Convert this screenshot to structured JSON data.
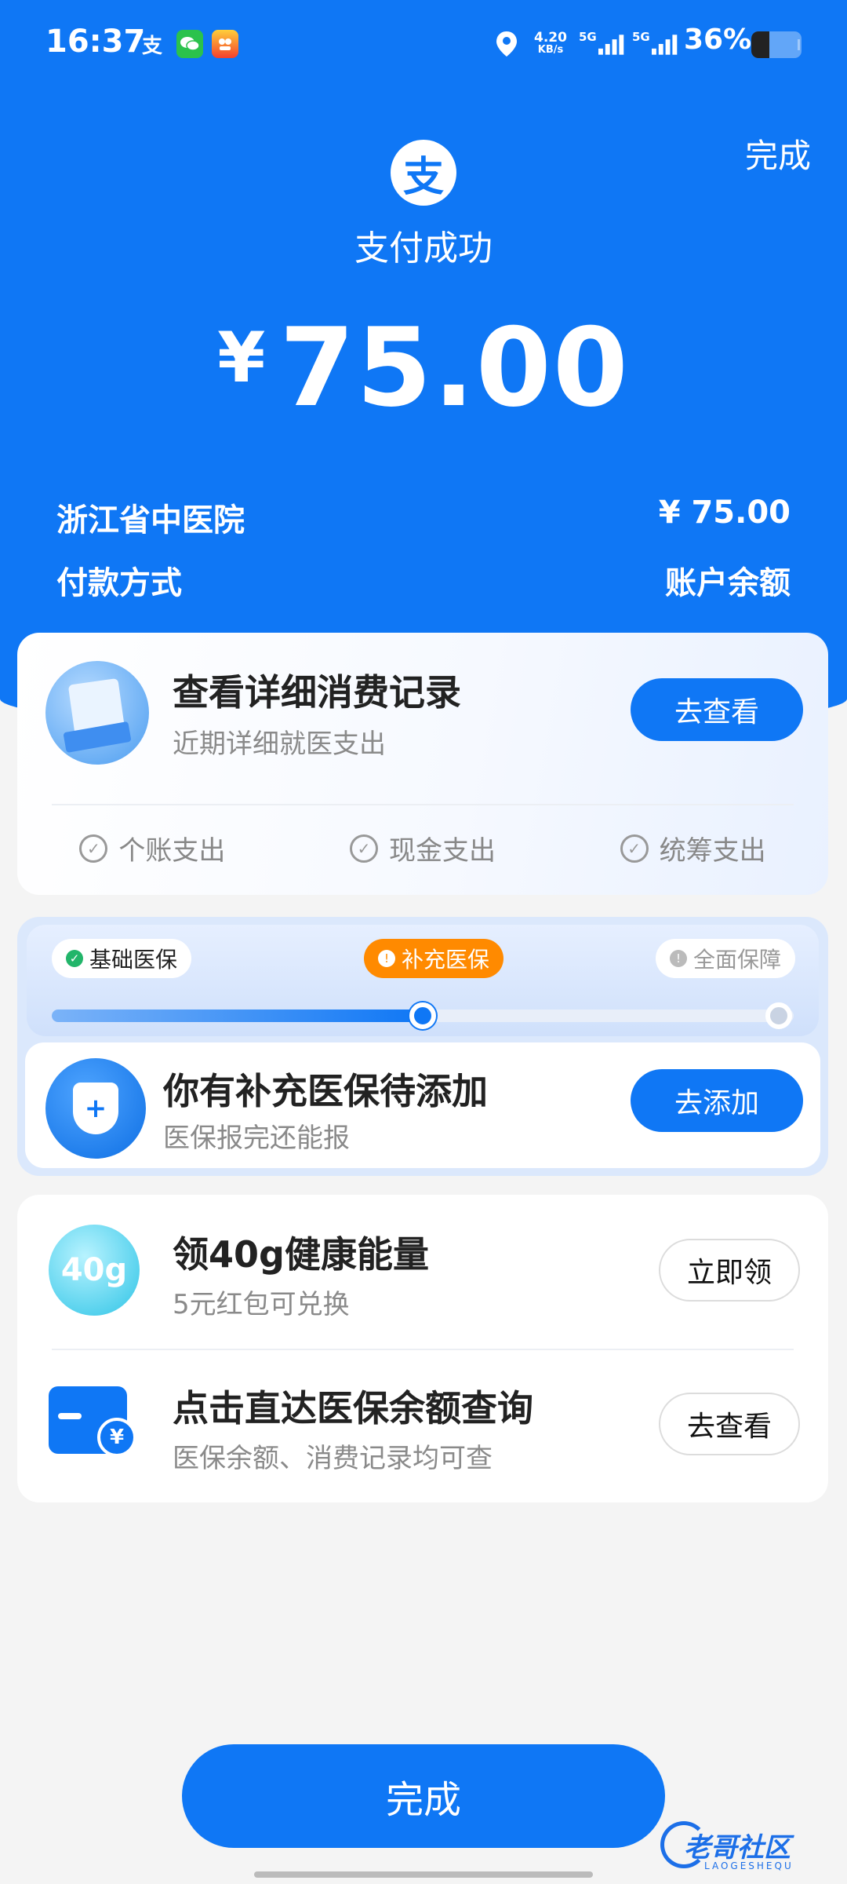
{
  "status_bar": {
    "time": "16:37",
    "app_alipay_glyph": "支",
    "network_speed": "4.20",
    "network_unit": "KB/s",
    "signal1_label": "5G",
    "signal2_label": "5G",
    "battery": "36%",
    "battery_level": 0.36
  },
  "header": {
    "done_label": "完成",
    "logo_glyph": "支",
    "title": "支付成功",
    "currency": "¥",
    "amount": "75.00"
  },
  "summary": {
    "merchant": "浙江省中医院",
    "merchant_amount": "¥ 75.00",
    "payment_method_label": "付款方式",
    "payment_method_value": "账户余额"
  },
  "records_card": {
    "title": "查看详细消费记录",
    "subtitle": "近期详细就医支出",
    "button": "去查看",
    "checks": [
      "个账支出",
      "现金支出",
      "统筹支出"
    ]
  },
  "insurance_card": {
    "steps": [
      "基础医保",
      "补充医保",
      "全面保障"
    ],
    "progress": 0.5,
    "title": "你有补充医保待添加",
    "subtitle": "医保报完还能报",
    "button": "去添加"
  },
  "energy_item": {
    "icon_text": "40g",
    "title": "领40g健康能量",
    "subtitle": "5元红包可兑换",
    "button": "立即领"
  },
  "balance_item": {
    "title": "点击直达医保余额查询",
    "subtitle": "医保余额、消费记录均可查",
    "button": "去查看"
  },
  "footer": {
    "done_label": "完成",
    "watermark": "老哥社区",
    "watermark_sub": "LAOGESHEQU"
  },
  "colors": {
    "brand_blue": "#0f77f5",
    "orange": "#ff8a00",
    "green": "#22b56a"
  }
}
